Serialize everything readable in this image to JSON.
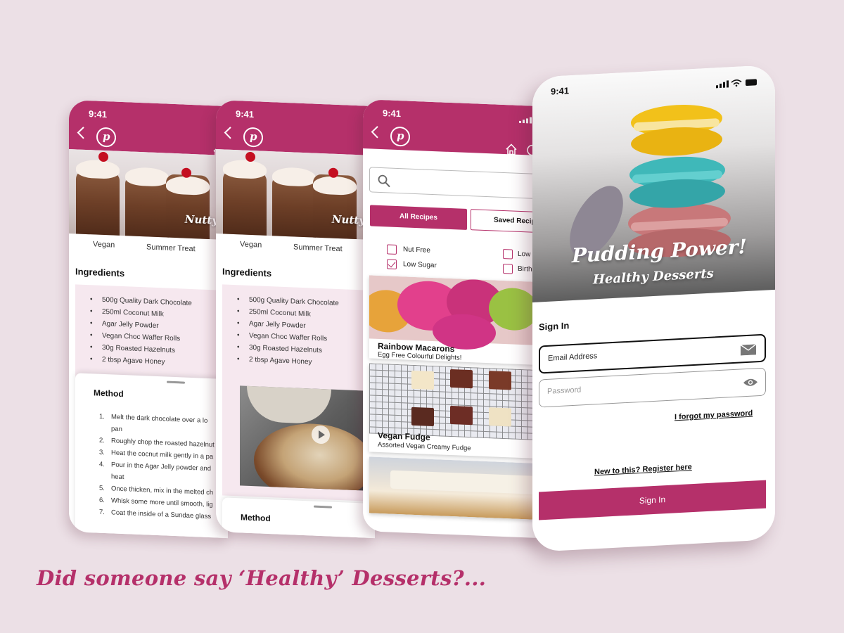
{
  "status": {
    "time": "9:41"
  },
  "brand": {
    "primary": "#b5306a",
    "logo_icon": "pudding-p-logo",
    "logo_letter": "p"
  },
  "recipe": {
    "hero_title": "Nutty Ch",
    "tags": [
      "Vegan",
      "Summer Treat"
    ],
    "ingredients_title": "Ingredients",
    "ingredients": [
      "500g Quality Dark Chocolate",
      "250ml Coconut Milk",
      "Agar Jelly Powder",
      "Vegan Choc Waffer Rolls",
      "30g Roasted Hazelnuts",
      "2 tbsp Agave Honey"
    ],
    "method_title": "Method",
    "method_steps": [
      {
        "num": "1.",
        "text": "Melt the dark chocolate over a lo"
      },
      {
        "num": "",
        "text": "pan"
      },
      {
        "num": "2.",
        "text": "Roughly chop the roasted hazelnut"
      },
      {
        "num": "3.",
        "text": "Heat the cocnut milk gently in a pa"
      },
      {
        "num": "4.",
        "text": "Pour in the Agar Jelly powder and"
      },
      {
        "num": "",
        "text": "heat"
      },
      {
        "num": "5.",
        "text": "Once thicken, mix in the melted ch"
      },
      {
        "num": "6.",
        "text": "Whisk some more until smooth, lig"
      },
      {
        "num": "7.",
        "text": "Coat the inside of a Sundae glass"
      }
    ]
  },
  "browse": {
    "search_placeholder": "",
    "tabs": [
      "All Recipes",
      "Saved Recip"
    ],
    "filters": [
      {
        "label": "Nut Free",
        "checked": false
      },
      {
        "label": "Low Sugar",
        "checked": true
      },
      {
        "label": "Low",
        "checked": false
      },
      {
        "label": "Birth",
        "checked": false
      }
    ],
    "cards": [
      {
        "title": "Rainbow Macarons",
        "subtitle": "Egg Free Colourful Delights!"
      },
      {
        "title": "Vegan Fudge",
        "subtitle": "Assorted Vegan Creamy Fudge"
      },
      {
        "title": "",
        "subtitle": ""
      }
    ]
  },
  "signin": {
    "hero_title": "Pudding Power!",
    "hero_subtitle": "Healthy Desserts",
    "title": "Sign In",
    "email_placeholder": "Email Address",
    "password_placeholder": "Password",
    "forgot": "I forgot my password",
    "register": "New to this? Register here",
    "button": "Sign In"
  },
  "tagline": "Did someone say ‘Healthy’ Desserts?..."
}
